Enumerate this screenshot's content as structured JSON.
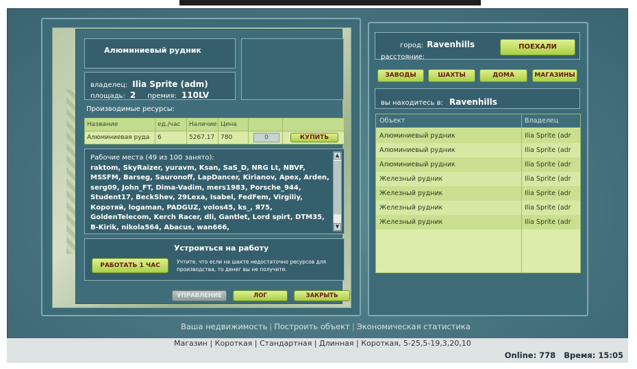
{
  "building": {
    "title": "Алюминиевый рудник",
    "owner_label": "владелец:",
    "owner_value": "Ilia Sprite (adm)",
    "area_label": "площадь:",
    "area_value": "2",
    "premium_label": "премия:",
    "premium_value": "110LV"
  },
  "resources": {
    "label": "Производимые ресурсы:",
    "columns": [
      "Название",
      "ед./час",
      "Наличие",
      "Цена"
    ],
    "row": {
      "name": "Алюминиевая руда",
      "rate": "6",
      "stock": "5267.17",
      "price": "780",
      "qty": "0"
    },
    "buy_label": "КУПИТЬ"
  },
  "workers": {
    "header": "Рабочие места (49 из 100 занято):",
    "list": "raktom, SkyRaizer, yuravm, Ksan, SaS_D, NRG Lt, NBVF, MSSFM, Barseg, Sauronoff, LapDancer, Kirianov, Apex, Arden, serg09, John_FT, Dima-Vadim, mers1983, Porsche_944, Student17, BeckShev, 29Lexa, Isabel, FedFem, Virgiliy, Коротяй, logaman, PADGUZ, volos45, ks_, Я75, GoldenTelecom, Kerch Racer, dli, Gantlet, Lord spirt, DTM35, B-Kirik, nikola564, Abacus, wan666,"
  },
  "job": {
    "title": "Устроиться на работу",
    "work_button": "РАБОТАТЬ 1 ЧАС",
    "note": "Учтите, что если на шахте недостаточно ресурсов для производства, то денег вы не получите."
  },
  "bottom_buttons": {
    "manage": "УПРАВЛЕНИЕ",
    "log": "ЛОГ",
    "close": "ЗАКРЫТЬ"
  },
  "city": {
    "city_label": "город:",
    "city_value": "Ravenhills",
    "distance_label": "расстояние:",
    "go_button": "ПОЕХАЛИ"
  },
  "categories": [
    "ЗАВОДЫ",
    "ШАХТЫ",
    "ДОМА",
    "МАГАЗИНЫ"
  ],
  "location": {
    "label": "вы находитесь в:",
    "value": "Ravenhills"
  },
  "objects": {
    "columns": [
      "Объект",
      "Владелец"
    ],
    "rows": [
      {
        "object": "Алюминиевый рудник",
        "owner": "Ilia Sprite (adr"
      },
      {
        "object": "Алюминиевый рудник",
        "owner": "Ilia Sprite (adr"
      },
      {
        "object": "Алюминиевый рудник",
        "owner": "Ilia Sprite (adr"
      },
      {
        "object": "Железный рудник",
        "owner": "Ilia Sprite (adr"
      },
      {
        "object": "Железный рудник",
        "owner": "Ilia Sprite (adr"
      },
      {
        "object": "Железный рудник",
        "owner": "Ilia Sprite (adr"
      },
      {
        "object": "Железный рудник",
        "owner": "Ilia Sprite (adr"
      }
    ]
  },
  "links": [
    "Ваша недвижимость",
    "Построить объект",
    "Экономическая статистика"
  ],
  "ticker": "Магазин | Короткая | Стандартная | Длинная | Короткая, 5-25,5-19,3,20,10",
  "status": {
    "online": "Online: 778",
    "time": "Время: 15:05"
  },
  "colors": {
    "accent_green": "#c3dc8d",
    "panel_teal": "#3d6b78",
    "button_text": "#6a1a10"
  }
}
